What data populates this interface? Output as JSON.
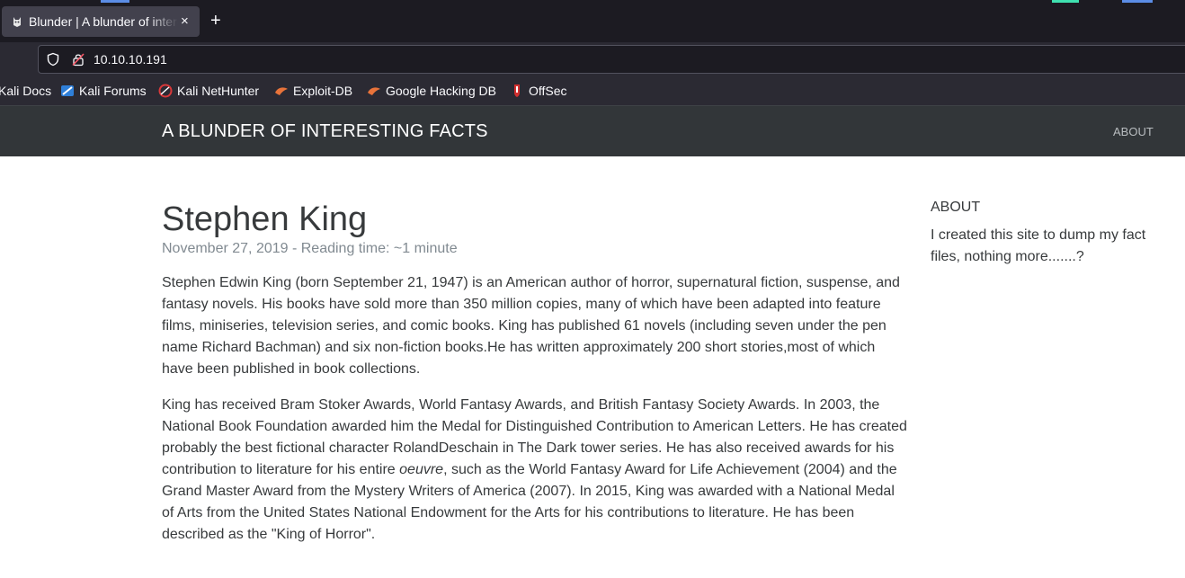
{
  "browser": {
    "tab_title": "Blunder | A blunder of interesting facts",
    "url": "10.10.10.191",
    "bookmarks": [
      {
        "label": "Kali Docs",
        "icon": "kali-icon"
      },
      {
        "label": "Kali Forums",
        "icon": "kali-forums-icon"
      },
      {
        "label": "Kali NetHunter",
        "icon": "nethunter-icon"
      },
      {
        "label": "Exploit-DB",
        "icon": "exploit-db-icon"
      },
      {
        "label": "Google Hacking DB",
        "icon": "ghdb-icon"
      },
      {
        "label": "OffSec",
        "icon": "offsec-icon"
      }
    ]
  },
  "site": {
    "title": "A BLUNDER OF INTERESTING FACTS",
    "nav_about": "ABOUT"
  },
  "post": {
    "title": "Stephen King",
    "meta": "November 27, 2019 - Reading time: ~1 minute",
    "p1": "Stephen Edwin King (born September 21, 1947) is an American author of horror, supernatural fiction, suspense, and fantasy novels. His books have sold more than 350 million copies, many of which have been adapted into feature films, miniseries, television series, and comic books. King has published 61 novels (including seven under the pen name Richard Bachman) and six non-fiction books.He has written approximately 200 short stories,most of which have been published in book collections.",
    "p2_before": "King has received Bram Stoker Awards, World Fantasy Awards, and British Fantasy Society Awards. In 2003, the National Book Foundation awarded him the Medal for Distinguished Contribution to American Letters. He has created probably the best fictional character RolandDeschain in The Dark tower series. He has also received awards for his contribution to literature for his entire ",
    "p2_em": "oeuvre",
    "p2_after": ", such as the World Fantasy Award for Life Achievement (2004) and the Grand Master Award from the Mystery Writers of America (2007). In 2015, King was awarded with a National Medal of Arts from the United States National Endowment for the Arts for his contributions to literature. He has been described as the \"King of Horror\"."
  },
  "sidebar": {
    "title": "ABOUT",
    "text": "I created this site to dump my fact files, nothing more.......?"
  },
  "colors": {
    "chrome_dark": "#1c1b22",
    "chrome": "#2b2a33",
    "header_bg": "#323639",
    "text": "#373a3c",
    "muted": "#818a91"
  }
}
